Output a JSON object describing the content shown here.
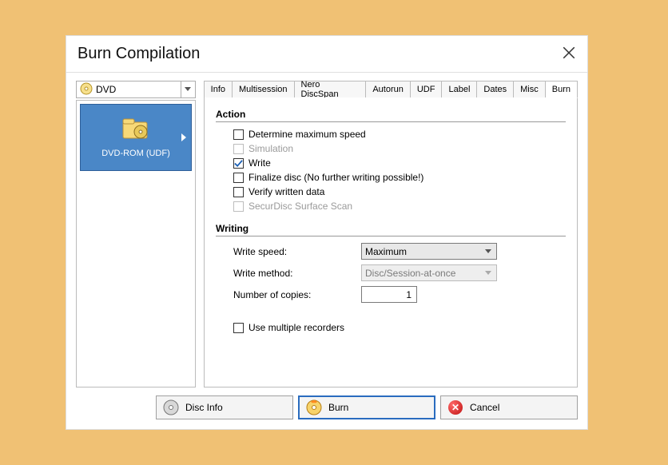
{
  "window": {
    "title": "Burn Compilation"
  },
  "discSelect": {
    "value": "DVD"
  },
  "tabs": [
    {
      "label": "Info"
    },
    {
      "label": "Multisession"
    },
    {
      "label": "Nero DiscSpan"
    },
    {
      "label": "Autorun"
    },
    {
      "label": "UDF"
    },
    {
      "label": "Label"
    },
    {
      "label": "Dates"
    },
    {
      "label": "Misc"
    },
    {
      "label": "Burn"
    }
  ],
  "activeTab": "Burn",
  "compilation": {
    "name": "DVD-ROM (UDF)"
  },
  "sections": {
    "action": {
      "header": "Action",
      "items": {
        "determineMax": {
          "label": "Determine maximum speed",
          "checked": false,
          "enabled": true
        },
        "simulation": {
          "label": "Simulation",
          "checked": false,
          "enabled": false
        },
        "write": {
          "label": "Write",
          "checked": true,
          "enabled": true
        },
        "finalize": {
          "label": "Finalize disc (No further writing possible!)",
          "checked": false,
          "enabled": true
        },
        "verify": {
          "label": "Verify written data",
          "checked": false,
          "enabled": true
        },
        "securdisc": {
          "label": "SecurDisc Surface Scan",
          "checked": false,
          "enabled": false
        }
      }
    },
    "writing": {
      "header": "Writing",
      "writeSpeed": {
        "label": "Write speed:",
        "value": "Maximum"
      },
      "writeMethod": {
        "label": "Write method:",
        "value": "Disc/Session-at-once",
        "enabled": false
      },
      "copies": {
        "label": "Number of copies:",
        "value": "1"
      },
      "multiRecorders": {
        "label": "Use multiple recorders",
        "checked": false
      }
    }
  },
  "buttons": {
    "discInfo": "Disc Info",
    "burn": "Burn",
    "cancel": "Cancel"
  }
}
